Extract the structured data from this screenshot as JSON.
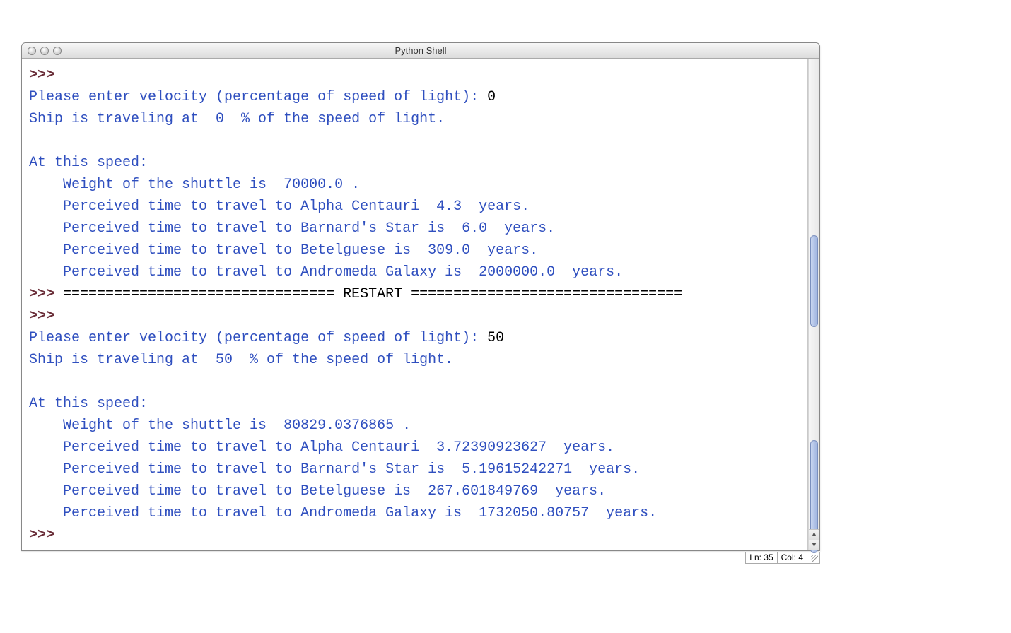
{
  "window": {
    "title": "Python Shell"
  },
  "status": {
    "line_label": "Ln: 35",
    "col_label": "Col: 4"
  },
  "prompt": ">>> ",
  "indent": "    ",
  "restart_text": "================================ RESTART ================================",
  "sessions": [
    {
      "prompt_text": "Please enter velocity (percentage of speed of light): ",
      "input_value": "0",
      "travel_line": "Ship is traveling at  0  % of the speed of light.",
      "header": "At this speed:",
      "weight_line": "Weight of the shuttle is  70000.0 .",
      "lines": [
        "Perceived time to travel to Alpha Centauri  4.3  years.",
        "Perceived time to travel to Barnard's Star is  6.0  years.",
        "Perceived time to travel to Betelguese is  309.0  years.",
        "Perceived time to travel to Andromeda Galaxy is  2000000.0  years."
      ]
    },
    {
      "prompt_text": "Please enter velocity (percentage of speed of light): ",
      "input_value": "50",
      "travel_line": "Ship is traveling at  50  % of the speed of light.",
      "header": "At this speed:",
      "weight_line": "Weight of the shuttle is  80829.0376865 .",
      "lines": [
        "Perceived time to travel to Alpha Centauri  3.72390923627  years.",
        "Perceived time to travel to Barnard's Star is  5.19615242271  years.",
        "Perceived time to travel to Betelguese is  267.601849769  years.",
        "Perceived time to travel to Andromeda Galaxy is  1732050.80757  years."
      ]
    }
  ]
}
